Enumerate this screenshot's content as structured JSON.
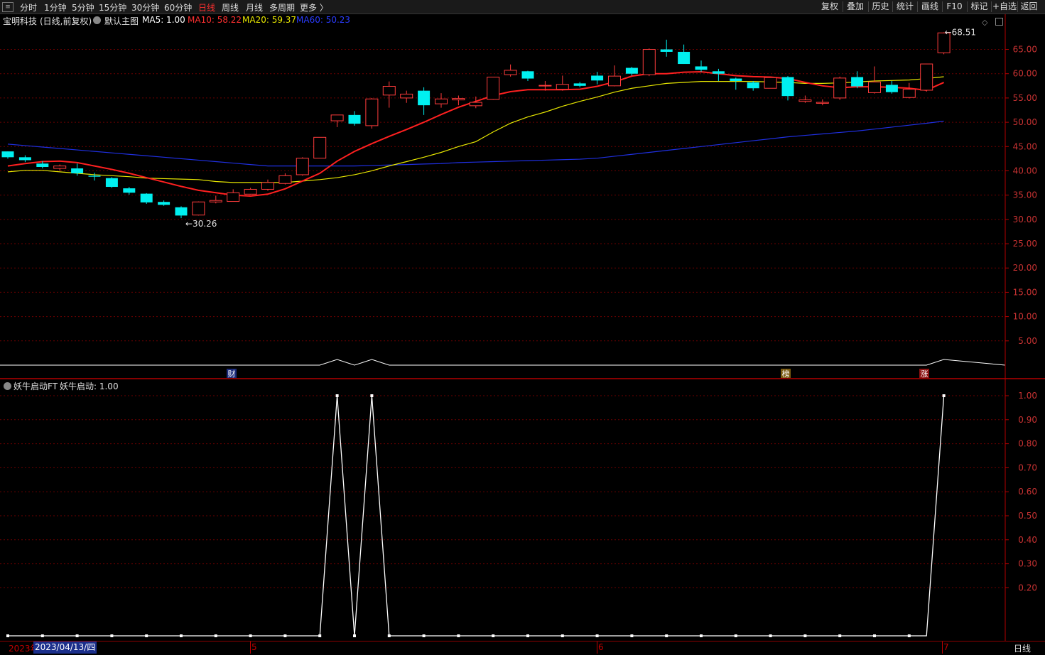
{
  "toolbar": {
    "menu_icon": "menu-icon",
    "periods": [
      "分时",
      "1分钟",
      "5分钟",
      "15分钟",
      "30分钟",
      "60分钟",
      "日线",
      "周线",
      "月线",
      "多周期",
      "更多 〉"
    ],
    "active_period": "日线",
    "right_buttons": [
      "复权",
      "叠加",
      "历史",
      "统计",
      "画线",
      "F10",
      "标记",
      "+自选",
      "返回"
    ]
  },
  "main_chart_header": {
    "stock": "宝明科技",
    "mode": "(日线,前复权)",
    "template": "默认主图",
    "ma5": "MA5: 1.00",
    "ma10": "MA10: 58.22",
    "ma20": "MA20: 59.37",
    "ma60": "MA60: 50.23"
  },
  "indicator_header": {
    "name": "妖牛启动FT",
    "value": "妖牛启动: 1.00"
  },
  "markers": {
    "low": "←30.26",
    "high": "←68.51",
    "event_cai": "财",
    "event_bang": "榜",
    "event_zhang": "涨"
  },
  "bottom": {
    "year_label": "2023年",
    "cursor_date": "2023/04/13/四",
    "months": [
      "5",
      "6",
      "7"
    ],
    "period_label": "日线"
  },
  "colors": {
    "up": "#ff3c3c",
    "down": "#00f0f0",
    "ma5": "#ffffff",
    "ma10": "#ff2020",
    "ma20": "#e6e600",
    "ma60": "#1f2fe0",
    "grid": "#6b0000",
    "axis": "#b40000"
  },
  "chart_data": [
    {
      "type": "candlestick",
      "title": "宝明科技 (日线,前复权)",
      "ylim": [
        0,
        69
      ],
      "y_ticks": [
        "65.00",
        "60.00",
        "55.00",
        "50.00",
        "45.00",
        "40.00",
        "35.00",
        "30.00",
        "25.00",
        "20.00",
        "15.00",
        "10.00",
        "5.00"
      ],
      "candles": [
        {
          "o": 44.0,
          "h": 44.0,
          "l": 42.5,
          "c": 42.8
        },
        {
          "o": 42.8,
          "h": 43.2,
          "l": 41.8,
          "c": 42.2
        },
        {
          "o": 41.5,
          "h": 42.0,
          "l": 40.5,
          "c": 40.8
        },
        {
          "o": 40.5,
          "h": 41.3,
          "l": 40.0,
          "c": 41.0
        },
        {
          "o": 40.5,
          "h": 41.5,
          "l": 39.0,
          "c": 39.5
        },
        {
          "o": 39.0,
          "h": 39.6,
          "l": 38.0,
          "c": 38.8
        },
        {
          "o": 38.5,
          "h": 38.7,
          "l": 36.5,
          "c": 36.7
        },
        {
          "o": 36.4,
          "h": 36.7,
          "l": 35.1,
          "c": 35.5
        },
        {
          "o": 35.3,
          "h": 35.4,
          "l": 33.2,
          "c": 33.5
        },
        {
          "o": 33.6,
          "h": 33.9,
          "l": 32.8,
          "c": 33.0
        },
        {
          "o": 32.5,
          "h": 32.7,
          "l": 30.26,
          "c": 30.8
        },
        {
          "o": 30.9,
          "h": 33.7,
          "l": 30.8,
          "c": 33.6
        },
        {
          "o": 33.6,
          "h": 34.9,
          "l": 33.3,
          "c": 33.9
        },
        {
          "o": 33.7,
          "h": 36.2,
          "l": 33.7,
          "c": 35.5
        },
        {
          "o": 35.2,
          "h": 36.5,
          "l": 35.1,
          "c": 36.2
        },
        {
          "o": 36.2,
          "h": 38.2,
          "l": 35.9,
          "c": 37.6
        },
        {
          "o": 37.4,
          "h": 39.5,
          "l": 37.2,
          "c": 39.0
        },
        {
          "o": 39.2,
          "h": 42.8,
          "l": 39.0,
          "c": 42.6
        },
        {
          "o": 42.6,
          "h": 46.9,
          "l": 42.6,
          "c": 46.9
        },
        {
          "o": 50.3,
          "h": 51.5,
          "l": 49.0,
          "c": 51.5
        },
        {
          "o": 51.5,
          "h": 52.3,
          "l": 49.3,
          "c": 49.7
        },
        {
          "o": 49.3,
          "h": 55.0,
          "l": 48.7,
          "c": 54.8
        },
        {
          "o": 55.6,
          "h": 58.4,
          "l": 53.0,
          "c": 57.4
        },
        {
          "o": 55.0,
          "h": 56.5,
          "l": 54.0,
          "c": 55.8
        },
        {
          "o": 56.5,
          "h": 57.2,
          "l": 51.5,
          "c": 53.5
        },
        {
          "o": 53.8,
          "h": 56.0,
          "l": 53.0,
          "c": 54.8
        },
        {
          "o": 54.6,
          "h": 55.5,
          "l": 53.5,
          "c": 54.9
        },
        {
          "o": 53.4,
          "h": 55.3,
          "l": 52.9,
          "c": 54.1
        },
        {
          "o": 54.7,
          "h": 59.3,
          "l": 54.6,
          "c": 59.3
        },
        {
          "o": 59.8,
          "h": 61.9,
          "l": 59.4,
          "c": 60.7
        },
        {
          "o": 60.5,
          "h": 60.6,
          "l": 58.5,
          "c": 59.0
        },
        {
          "o": 57.5,
          "h": 58.5,
          "l": 56.5,
          "c": 57.6
        },
        {
          "o": 56.8,
          "h": 59.6,
          "l": 56.5,
          "c": 57.8
        },
        {
          "o": 58.0,
          "h": 58.3,
          "l": 57.2,
          "c": 57.5
        },
        {
          "o": 59.6,
          "h": 60.4,
          "l": 57.8,
          "c": 58.6
        },
        {
          "o": 57.5,
          "h": 61.7,
          "l": 57.4,
          "c": 59.5
        },
        {
          "o": 61.2,
          "h": 61.4,
          "l": 59.6,
          "c": 60.0
        },
        {
          "o": 59.8,
          "h": 65.2,
          "l": 59.5,
          "c": 65.0
        },
        {
          "o": 65.0,
          "h": 67.0,
          "l": 63.5,
          "c": 64.5
        },
        {
          "o": 64.5,
          "h": 66.0,
          "l": 62.0,
          "c": 62.0
        },
        {
          "o": 61.5,
          "h": 62.7,
          "l": 60.4,
          "c": 60.8
        },
        {
          "o": 60.5,
          "h": 61.0,
          "l": 58.5,
          "c": 60.0
        },
        {
          "o": 59.0,
          "h": 59.2,
          "l": 56.7,
          "c": 58.5
        },
        {
          "o": 58.2,
          "h": 58.5,
          "l": 56.5,
          "c": 57.0
        },
        {
          "o": 57.0,
          "h": 58.3,
          "l": 57.0,
          "c": 59.2
        },
        {
          "o": 59.3,
          "h": 59.5,
          "l": 54.5,
          "c": 55.4
        },
        {
          "o": 54.3,
          "h": 55.5,
          "l": 54.0,
          "c": 54.6
        },
        {
          "o": 53.9,
          "h": 54.7,
          "l": 53.5,
          "c": 54.1
        },
        {
          "o": 55.0,
          "h": 59.4,
          "l": 54.6,
          "c": 59.1
        },
        {
          "o": 59.3,
          "h": 60.5,
          "l": 57.0,
          "c": 57.4
        },
        {
          "o": 56.1,
          "h": 61.5,
          "l": 55.9,
          "c": 58.3
        },
        {
          "o": 57.7,
          "h": 58.5,
          "l": 55.9,
          "c": 56.2
        },
        {
          "o": 55.1,
          "h": 58.1,
          "l": 54.9,
          "c": 56.8
        },
        {
          "o": 56.6,
          "h": 62.0,
          "l": 56.3,
          "c": 62.0
        },
        {
          "o": 64.3,
          "h": 68.51,
          "l": 64.0,
          "c": 68.4
        }
      ],
      "ma10": [
        41.0,
        41.5,
        41.9,
        42.0,
        41.7,
        41.0,
        40.3,
        39.5,
        38.6,
        37.7,
        36.8,
        36.0,
        35.5,
        35.0,
        34.8,
        35.2,
        36.3,
        37.9,
        39.5,
        42.0,
        44.0,
        45.6,
        47.1,
        48.5,
        50.0,
        51.6,
        53.1,
        54.3,
        55.5,
        56.3,
        56.7,
        56.7,
        56.7,
        56.8,
        57.4,
        58.3,
        59.5,
        60.0,
        60.0,
        60.3,
        60.4,
        60.0,
        59.6,
        59.4,
        59.3,
        59.0,
        58.2,
        57.5,
        57.1,
        57.3,
        57.3,
        57.2,
        57.0,
        56.6,
        58.2
      ],
      "ma20": [
        39.8,
        40.1,
        40.1,
        39.8,
        39.5,
        39.2,
        39.0,
        38.8,
        38.5,
        38.4,
        38.3,
        38.2,
        37.8,
        37.6,
        37.6,
        37.6,
        37.6,
        37.9,
        38.2,
        38.6,
        39.2,
        40.0,
        41.0,
        41.9,
        42.8,
        43.8,
        45.0,
        46.0,
        48.0,
        49.8,
        51.1,
        52.1,
        53.3,
        54.3,
        55.2,
        56.2,
        57.0,
        57.5,
        58.0,
        58.2,
        58.4,
        58.4,
        58.4,
        58.4,
        58.3,
        58.2,
        58.0,
        58.0,
        58.1,
        58.3,
        58.5,
        58.6,
        58.7,
        59.0,
        59.37
      ],
      "ma60": [
        45.5,
        45.2,
        44.9,
        44.6,
        44.3,
        44.0,
        43.7,
        43.4,
        43.1,
        42.8,
        42.5,
        42.2,
        41.9,
        41.6,
        41.3,
        41.0,
        41.0,
        41.0,
        41.0,
        41.0,
        41.0,
        41.1,
        41.2,
        41.3,
        41.4,
        41.5,
        41.7,
        41.8,
        41.9,
        42.0,
        42.1,
        42.2,
        42.3,
        42.4,
        42.6,
        43.0,
        43.4,
        43.8,
        44.2,
        44.6,
        45.0,
        45.4,
        45.8,
        46.2,
        46.6,
        47.0,
        47.3,
        47.6,
        47.9,
        48.2,
        48.6,
        49.0,
        49.4,
        49.8,
        50.23
      ]
    },
    {
      "type": "line",
      "title": "妖牛启动FT",
      "series": [
        {
          "name": "妖牛启动",
          "values": [
            0,
            0,
            0,
            0,
            0,
            0,
            0,
            0,
            0,
            0,
            0,
            0,
            0,
            0,
            0,
            0,
            0,
            0,
            0,
            1,
            0,
            1,
            0,
            0,
            0,
            0,
            0,
            0,
            0,
            0,
            0,
            0,
            0,
            0,
            0,
            0,
            0,
            0,
            0,
            0,
            0,
            0,
            0,
            0,
            0,
            0,
            0,
            0,
            0,
            0,
            0,
            0,
            0,
            0,
            1
          ]
        }
      ],
      "ylim": [
        0,
        1.0
      ],
      "y_ticks": [
        "1.00",
        "0.90",
        "0.80",
        "0.70",
        "0.60",
        "0.50",
        "0.40",
        "0.30",
        "0.20"
      ]
    }
  ]
}
